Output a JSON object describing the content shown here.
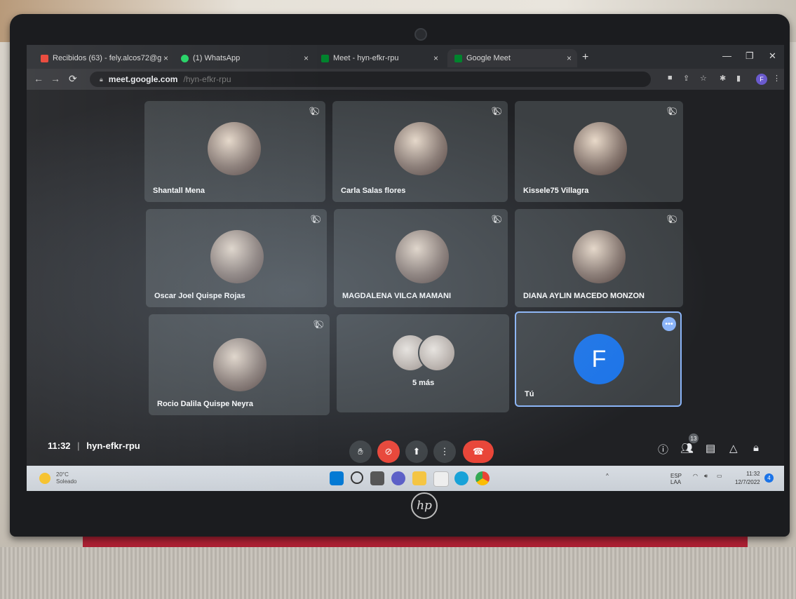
{
  "browser": {
    "tabs": [
      {
        "label": "Recibidos (63) - fely.alcos72@g",
        "close": "×",
        "color": "#ea4335"
      },
      {
        "label": "(1) WhatsApp",
        "close": "×",
        "color": "#25d366"
      },
      {
        "label": "Meet - hyn-efkr-rpu",
        "close": "×",
        "color": "#00832d"
      },
      {
        "label": "Google Meet",
        "close": "×",
        "color": "#00832d"
      }
    ],
    "new_tab": "+",
    "url": "meet.google.com",
    "url_path": "/hyn-efkr-rpu",
    "profile_initial": "F"
  },
  "participants": [
    {
      "name": "Shantall Mena"
    },
    {
      "name": "Carla Salas flores"
    },
    {
      "name": "Kissele75 Villagra"
    },
    {
      "name": "Oscar Joel Quispe Rojas"
    },
    {
      "name": "MAGDALENA VILCA MAMANI"
    },
    {
      "name": "DIANA AYLIN MACEDO MONZON"
    },
    {
      "name": "Rocio Dalila Quispe Neyra"
    }
  ],
  "more_tile": {
    "label": "5 más"
  },
  "self_tile": {
    "name": "Tú",
    "initial": "F",
    "dots": "•••"
  },
  "meeting": {
    "time": "11:32",
    "separator": "|",
    "code": "hyn-efkr-rpu",
    "participant_count": "13"
  },
  "taskbar": {
    "weather_temp": "20°C",
    "weather_desc": "Soleado",
    "lang": "ESP",
    "lang_sub": "LAA",
    "time": "11:32",
    "date": "12/7/2022",
    "notifications": "4"
  },
  "colors": {
    "accent": "#8ab4f8",
    "hangup": "#ea4335",
    "self_avatar": "#1a73e8"
  }
}
